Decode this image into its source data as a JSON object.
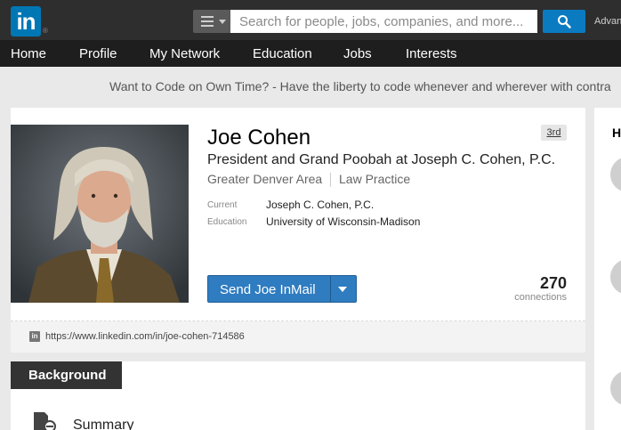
{
  "header": {
    "logo_text": "in",
    "logo_reg": "®",
    "search_placeholder": "Search for people, jobs, companies, and more...",
    "advanced_label": "Advanced"
  },
  "nav": {
    "items": [
      "Home",
      "Profile",
      "My Network",
      "Education",
      "Jobs",
      "Interests"
    ]
  },
  "ad": {
    "text": "Want to Code on Own Time? - Have the liberty to code whenever and wherever with contra"
  },
  "profile": {
    "name": "Joe Cohen",
    "headline": "President and Grand Poobah at Joseph C. Cohen, P.C.",
    "location": "Greater Denver Area",
    "industry": "Law Practice",
    "degree": "3rd",
    "current_label": "Current",
    "current_value": "Joseph C. Cohen, P.C.",
    "education_label": "Education",
    "education_value": "University of Wisconsin-Madison",
    "inmail_label": "Send Joe InMail",
    "connections_count": "270",
    "connections_label": "connections",
    "public_url": "https://www.linkedin.com/in/joe-cohen-714586"
  },
  "background": {
    "tab_label": "Background",
    "summary_label": "Summary"
  },
  "sidebar": {
    "heading_initial": "H"
  },
  "colors": {
    "brand_blue": "#0077b5",
    "button_blue": "#2f7cc0",
    "topbar": "#2e2e2e",
    "navbar": "#1e1e1e"
  },
  "icons": [
    "linkedin-logo",
    "menu-icon",
    "search-icon",
    "chevron-down-icon",
    "linkedin-mini-icon",
    "summary-doc-icon"
  ]
}
